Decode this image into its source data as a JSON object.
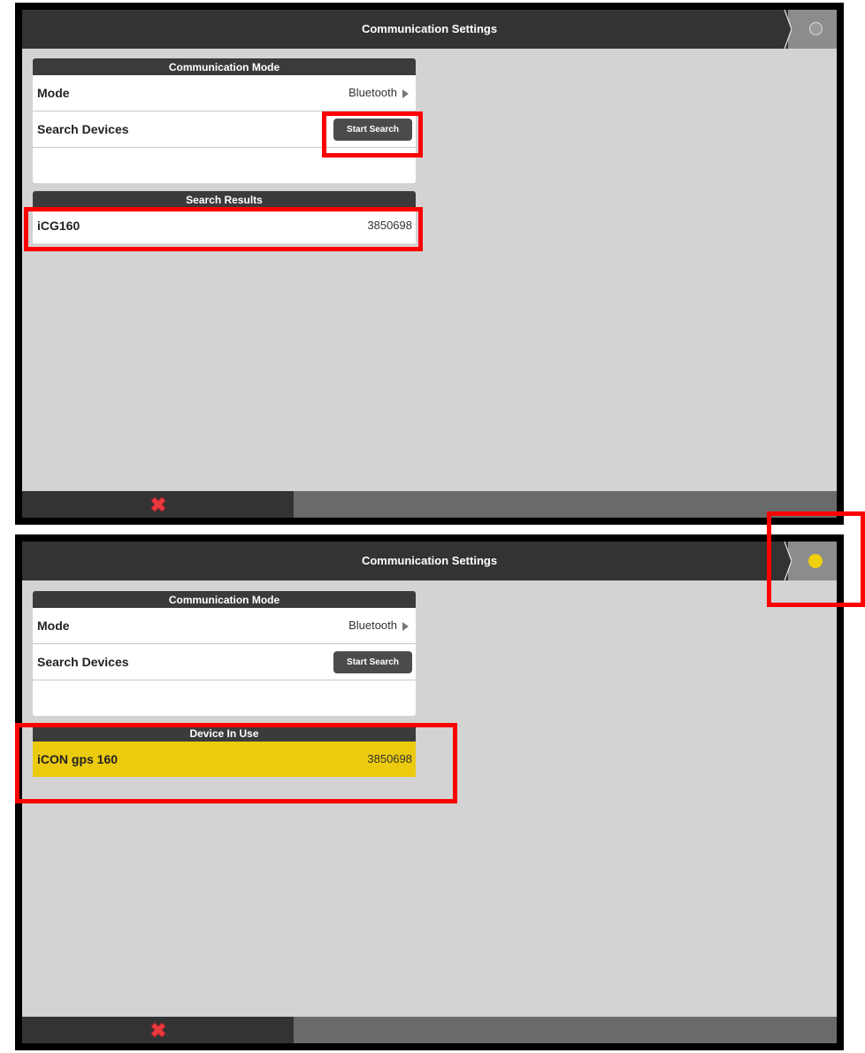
{
  "screens": [
    {
      "title": "Communication Settings",
      "status_dot": "empty",
      "mode_header": "Communication Mode",
      "mode_label": "Mode",
      "mode_value": "Bluetooth",
      "search_label": "Search Devices",
      "search_button": "Start Search",
      "results_header": "Search Results",
      "device_name": "iCG160",
      "device_serial": "3850698"
    },
    {
      "title": "Communication Settings",
      "status_dot": "filled",
      "mode_header": "Communication Mode",
      "mode_label": "Mode",
      "mode_value": "Bluetooth",
      "search_label": "Search Devices",
      "search_button": "Start Search",
      "results_header": "Device In Use",
      "device_name": "iCON gps 160",
      "device_serial": "3850698"
    }
  ],
  "colors": {
    "highlight": "#ff0000",
    "in_use": "#ecca0e",
    "status_connected": "#f0cf0f",
    "close_icon": "#e8393f"
  },
  "icons": [
    "close-icon",
    "chevron-right-icon",
    "status-dot-icon"
  ]
}
